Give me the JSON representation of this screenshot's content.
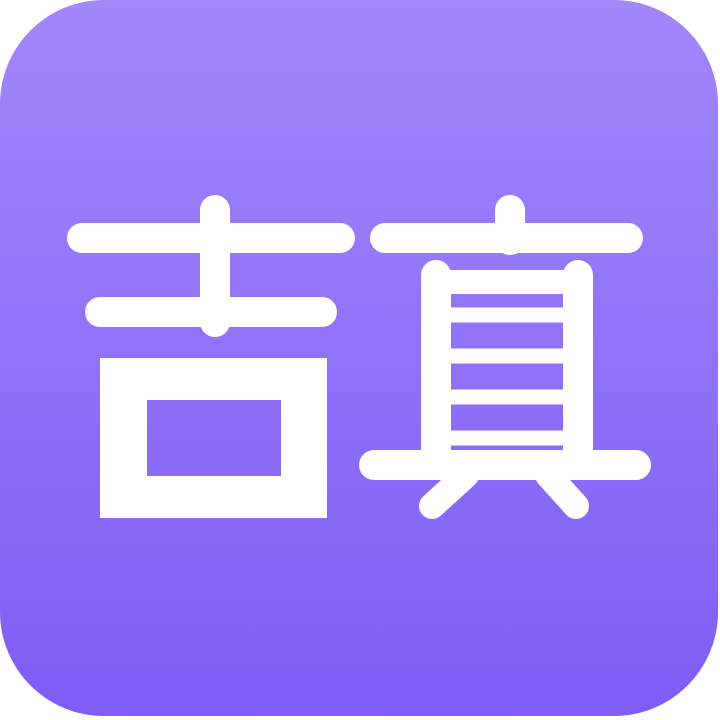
{
  "icon": {
    "glyph_text": "吉真",
    "colors": {
      "background_top": "#A287FB",
      "background_bottom": "#7F5CF5",
      "glyph": "#FFFFFF"
    }
  }
}
